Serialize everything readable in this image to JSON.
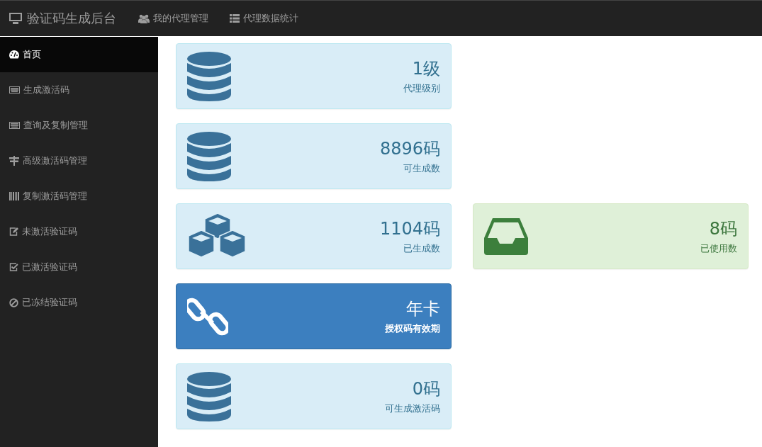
{
  "navbar": {
    "brand": "验证码生成后台",
    "links": [
      {
        "label": "我的代理管理",
        "kind": "users"
      },
      {
        "label": "代理数据统计",
        "kind": "list"
      }
    ]
  },
  "sidebar": {
    "items": [
      {
        "label": "首页",
        "kind": "dashboard",
        "selected": true
      },
      {
        "label": "生成激活码",
        "kind": "keyboard",
        "selected": false
      },
      {
        "label": "查询及复制管理",
        "kind": "keyboard",
        "selected": false
      },
      {
        "label": "高级激活码管理",
        "kind": "signpost",
        "selected": false
      },
      {
        "label": "复制激活码管理",
        "kind": "barcode",
        "selected": false
      },
      {
        "label": "未激活验证码",
        "kind": "edit",
        "selected": false
      },
      {
        "label": "已激活验证码",
        "kind": "check",
        "selected": false
      },
      {
        "label": "已冻结验证码",
        "kind": "ban",
        "selected": false
      }
    ]
  },
  "rows": [
    [
      {
        "value": "1级",
        "label": "代理级别",
        "kind": "database"
      }
    ],
    [
      {
        "value": "8896码",
        "label": "可生成数",
        "kind": "database"
      }
    ],
    [
      {
        "value": "1104码",
        "label": "已生成数",
        "kind": "cubes"
      },
      {
        "value": "8码",
        "label": "已使用数",
        "kind": "inbox"
      }
    ],
    [
      {
        "value": "年卡",
        "label": "授权码有效期",
        "kind": "link"
      }
    ],
    [
      {
        "value": "0码",
        "label": "可生成激活码",
        "kind": "database"
      }
    ]
  ]
}
